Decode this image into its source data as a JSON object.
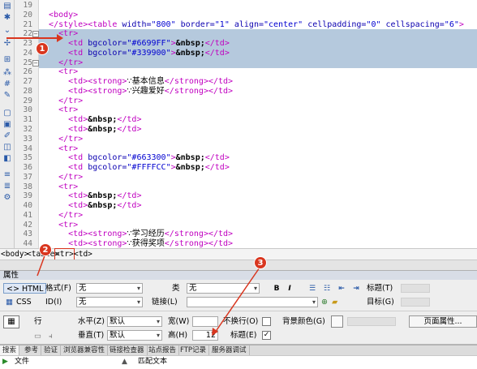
{
  "code": {
    "lines": [
      {
        "n": "19",
        "parts": []
      },
      {
        "n": "20",
        "parts": [
          [
            "tg",
            "<body>"
          ]
        ]
      },
      {
        "n": "21",
        "parts": [
          [
            "tg",
            "</style>"
          ],
          [
            "tg",
            "<table "
          ],
          [
            "tt",
            "width="
          ],
          [
            "av",
            "\"800\""
          ],
          [
            "tt",
            " border="
          ],
          [
            "av",
            "\"1\""
          ],
          [
            "tt",
            " align="
          ],
          [
            "av",
            "\"center\""
          ],
          [
            "tt",
            " cellpadding="
          ],
          [
            "av",
            "\"0\""
          ],
          [
            "tt",
            " cellspacing="
          ],
          [
            "av",
            "\"6\""
          ],
          [
            "tg",
            ">"
          ]
        ]
      },
      {
        "n": "22",
        "parts": [
          [
            "tx",
            "  "
          ],
          [
            "tg",
            "<tr>"
          ]
        ]
      },
      {
        "n": "23",
        "parts": [
          [
            "tx",
            "    "
          ],
          [
            "tg",
            "<td "
          ],
          [
            "tt",
            "bgcolor="
          ],
          [
            "av",
            "\"#6699FF\""
          ],
          [
            "tg",
            ">"
          ],
          [
            "ent",
            "&nbsp;"
          ],
          [
            "tg",
            "</td>"
          ]
        ]
      },
      {
        "n": "24",
        "parts": [
          [
            "tx",
            "    "
          ],
          [
            "tg",
            "<td "
          ],
          [
            "tt",
            "bgcolor="
          ],
          [
            "av",
            "\"#339900\""
          ],
          [
            "tg",
            ">"
          ],
          [
            "ent",
            "&nbsp;"
          ],
          [
            "tg",
            "</td>"
          ]
        ]
      },
      {
        "n": "25",
        "parts": [
          [
            "tx",
            "  "
          ],
          [
            "tg",
            "</tr>"
          ]
        ]
      },
      {
        "n": "26",
        "parts": [
          [
            "tx",
            "  "
          ],
          [
            "tg",
            "<tr>"
          ]
        ]
      },
      {
        "n": "27",
        "parts": [
          [
            "tx",
            "    "
          ],
          [
            "tg",
            "<td>"
          ],
          [
            "tg",
            "<strong>"
          ],
          [
            "cj",
            "∵基本信息"
          ],
          [
            "tg",
            "</strong>"
          ],
          [
            "tg",
            "</td>"
          ]
        ]
      },
      {
        "n": "28",
        "parts": [
          [
            "tx",
            "    "
          ],
          [
            "tg",
            "<td>"
          ],
          [
            "tg",
            "<strong>"
          ],
          [
            "cj",
            "∵兴趣爱好"
          ],
          [
            "tg",
            "</strong>"
          ],
          [
            "tg",
            "</td>"
          ]
        ]
      },
      {
        "n": "29",
        "parts": [
          [
            "tx",
            "  "
          ],
          [
            "tg",
            "</tr>"
          ]
        ]
      },
      {
        "n": "30",
        "parts": [
          [
            "tx",
            "  "
          ],
          [
            "tg",
            "<tr>"
          ]
        ]
      },
      {
        "n": "31",
        "parts": [
          [
            "tx",
            "    "
          ],
          [
            "tg",
            "<td>"
          ],
          [
            "ent",
            "&nbsp;"
          ],
          [
            "tg",
            "</td>"
          ]
        ]
      },
      {
        "n": "32",
        "parts": [
          [
            "tx",
            "    "
          ],
          [
            "tg",
            "<td>"
          ],
          [
            "ent",
            "&nbsp;"
          ],
          [
            "tg",
            "</td>"
          ]
        ]
      },
      {
        "n": "33",
        "parts": [
          [
            "tx",
            "  "
          ],
          [
            "tg",
            "</tr>"
          ]
        ]
      },
      {
        "n": "34",
        "parts": [
          [
            "tx",
            "  "
          ],
          [
            "tg",
            "<tr>"
          ]
        ]
      },
      {
        "n": "35",
        "parts": [
          [
            "tx",
            "    "
          ],
          [
            "tg",
            "<td "
          ],
          [
            "tt",
            "bgcolor="
          ],
          [
            "av",
            "\"#663300\""
          ],
          [
            "tg",
            ">"
          ],
          [
            "ent",
            "&nbsp;"
          ],
          [
            "tg",
            "</td>"
          ]
        ]
      },
      {
        "n": "36",
        "parts": [
          [
            "tx",
            "    "
          ],
          [
            "tg",
            "<td "
          ],
          [
            "tt",
            "bgcolor="
          ],
          [
            "av",
            "\"#FFFFCC\""
          ],
          [
            "tg",
            ">"
          ],
          [
            "ent",
            "&nbsp;"
          ],
          [
            "tg",
            "</td>"
          ]
        ]
      },
      {
        "n": "37",
        "parts": [
          [
            "tx",
            "  "
          ],
          [
            "tg",
            "</tr>"
          ]
        ]
      },
      {
        "n": "38",
        "parts": [
          [
            "tx",
            "  "
          ],
          [
            "tg",
            "<tr>"
          ]
        ]
      },
      {
        "n": "39",
        "parts": [
          [
            "tx",
            "    "
          ],
          [
            "tg",
            "<td>"
          ],
          [
            "ent",
            "&nbsp;"
          ],
          [
            "tg",
            "</td>"
          ]
        ]
      },
      {
        "n": "40",
        "parts": [
          [
            "tx",
            "    "
          ],
          [
            "tg",
            "<td>"
          ],
          [
            "ent",
            "&nbsp;"
          ],
          [
            "tg",
            "</td>"
          ]
        ]
      },
      {
        "n": "41",
        "parts": [
          [
            "tx",
            "  "
          ],
          [
            "tg",
            "</tr>"
          ]
        ]
      },
      {
        "n": "42",
        "parts": [
          [
            "tx",
            "  "
          ],
          [
            "tg",
            "<tr>"
          ]
        ]
      },
      {
        "n": "43",
        "parts": [
          [
            "tx",
            "    "
          ],
          [
            "tg",
            "<td>"
          ],
          [
            "tg",
            "<strong>"
          ],
          [
            "cj",
            "∵学习经历"
          ],
          [
            "tg",
            "</strong>"
          ],
          [
            "tg",
            "</td>"
          ]
        ]
      },
      {
        "n": "44",
        "parts": [
          [
            "tx",
            "    "
          ],
          [
            "tg",
            "<td>"
          ],
          [
            "tg",
            "<strong>"
          ],
          [
            "cj",
            "∵获得奖项"
          ],
          [
            "tg",
            "</strong>"
          ],
          [
            "tg",
            "</td>"
          ]
        ]
      }
    ],
    "selected_lines": [
      "22",
      "23",
      "24",
      "25"
    ],
    "fold_lines": [
      "22",
      "25"
    ]
  },
  "tag_selector": {
    "crumbs": [
      "<body>",
      "<table>",
      "<tr>",
      "<td>"
    ],
    "active": "<tr>"
  },
  "badges": {
    "one": "1",
    "two": "2",
    "three": "3"
  },
  "props": {
    "header": "属性",
    "html_btn": "<> HTML",
    "css_btn": "CSS",
    "format_label": "格式(F)",
    "format_value": "无",
    "id_label": "ID(I)",
    "id_value": "无",
    "class_label": "类",
    "class_value": "无",
    "link_label": "链接(L)",
    "link_value": "",
    "title_label": "标题(T)",
    "target_label": "目标(G)",
    "bold": "B",
    "italic": "I",
    "row_label": "行",
    "halign_label": "水平(Z)",
    "halign_value": "默认",
    "valign_label": "垂直(T)",
    "valign_value": "默认",
    "width_label": "宽(W)",
    "width_value": "",
    "height_label": "高(H)",
    "height_value": "12",
    "nowrap_label": "不换行(O)",
    "header_label": "标题(E)",
    "header_checked": "✓",
    "bgcolor_label": "背景颜色(G)",
    "page_props": "页面属性..."
  },
  "tabs": [
    "搜索",
    "参考",
    "验证",
    "浏览器兼容性",
    "链接检查器",
    "站点报告",
    "FTP记录",
    "服务器调试"
  ],
  "filelist": {
    "col1": "文件",
    "col2": "匹配文本"
  }
}
